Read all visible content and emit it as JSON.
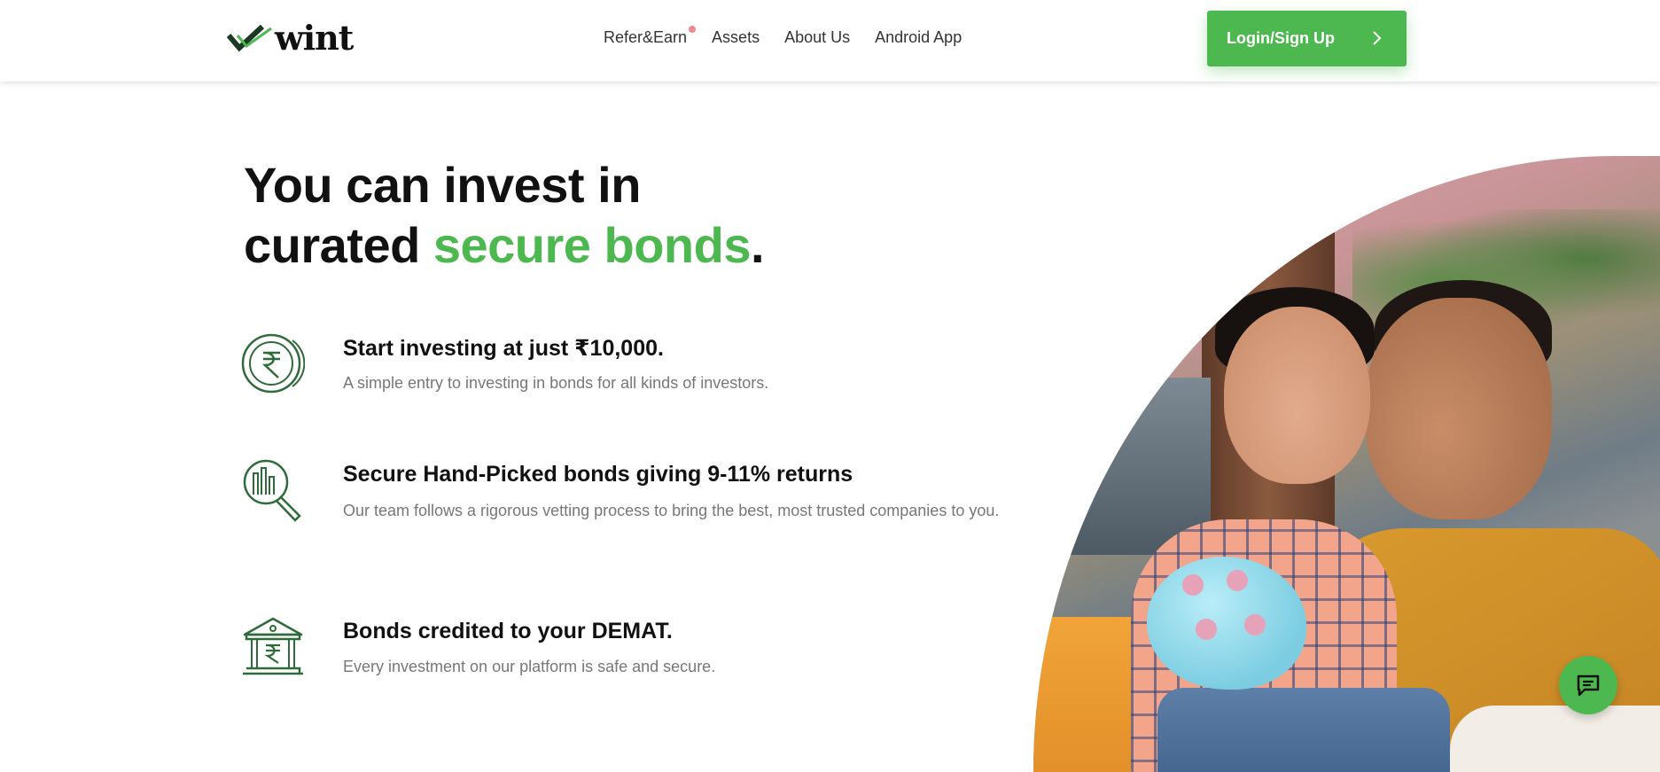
{
  "header": {
    "logo_text": "wint",
    "nav": [
      {
        "label": "Refer&Earn",
        "has_dot": true
      },
      {
        "label": "Assets"
      },
      {
        "label": "About Us"
      },
      {
        "label": "Android App"
      }
    ],
    "login_label": "Login/Sign Up"
  },
  "hero": {
    "line1": "You can invest in",
    "line2_prefix": "curated ",
    "line2_highlight": "secure bonds",
    "line2_suffix": "."
  },
  "features": [
    {
      "icon": "rupee-coin-icon",
      "title": "Start investing at just ₹10,000.",
      "desc": "A simple entry to investing in bonds for all kinds of investors."
    },
    {
      "icon": "chart-magnifier-icon",
      "title": "Secure Hand-Picked bonds giving 9-11% returns",
      "desc": "Our team follows a rigorous vetting process to bring the best, most trusted companies to you."
    },
    {
      "icon": "bank-rupee-icon",
      "title": "Bonds credited to your DEMAT.",
      "desc": "Every investment on our platform is safe and secure."
    }
  ],
  "colors": {
    "accent": "#4cb84f",
    "icon": "#2f6b3a",
    "text": "#111111",
    "muted": "#777777"
  },
  "chat": {
    "icon": "chat-icon"
  }
}
